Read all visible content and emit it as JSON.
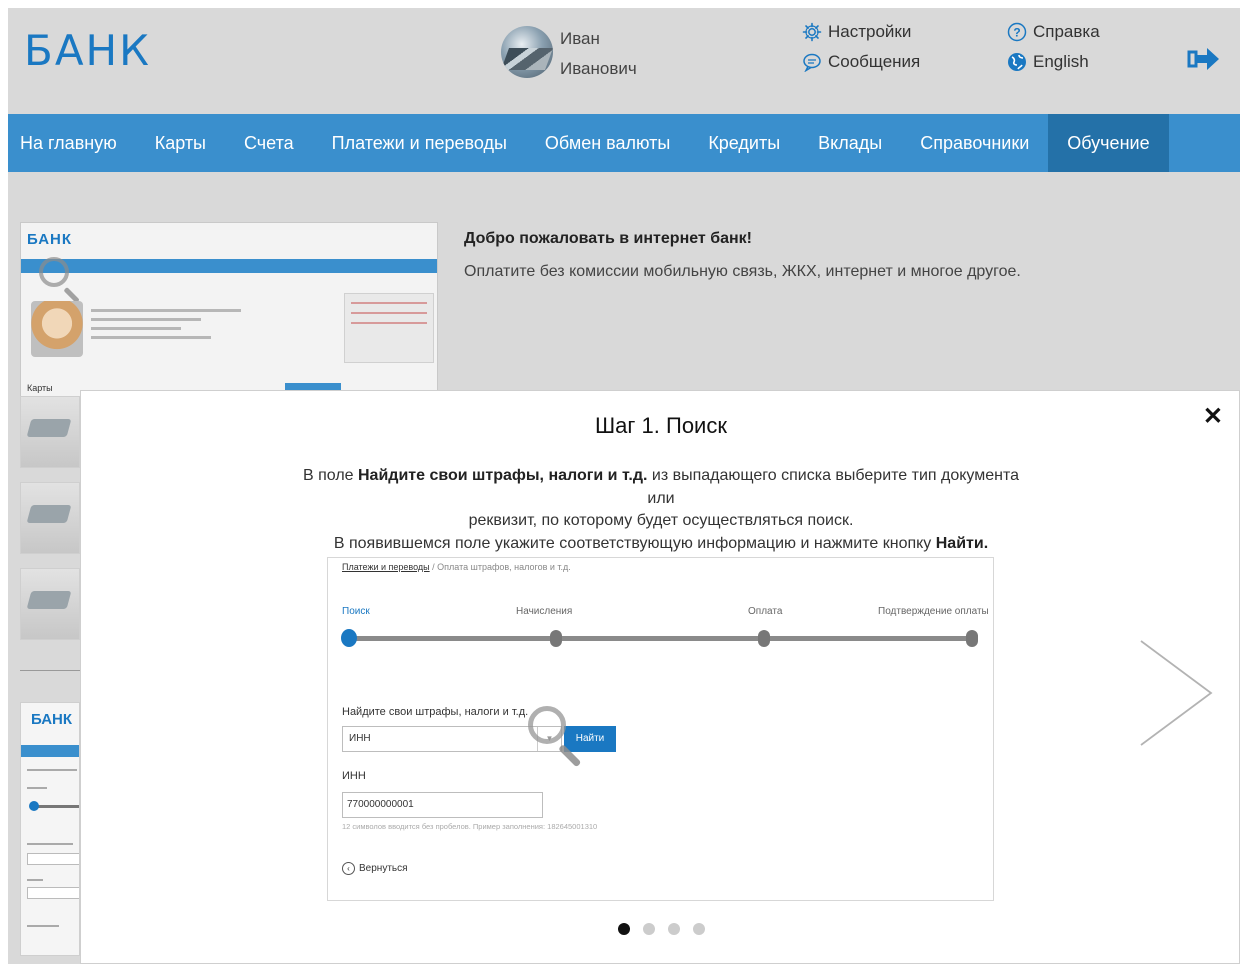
{
  "header": {
    "logo": "БАНК",
    "user": {
      "first_name": "Иван",
      "patronymic": "Иванович"
    },
    "links": {
      "settings": "Настройки",
      "messages": "Сообщения",
      "help": "Справка",
      "language": "English"
    },
    "colors": {
      "brand": "#1a78c2",
      "nav": "#3a8fcd",
      "nav_active": "#2471a8"
    }
  },
  "nav": {
    "items": [
      "На главную",
      "Карты",
      "Счета",
      "Платежи и переводы",
      "Обмен валюты",
      "Кредиты",
      "Вклады",
      "Справочники",
      "Обучение"
    ],
    "active": "Обучение"
  },
  "welcome": {
    "thumb_logo": "БАНК",
    "thumb_cards": "Карты",
    "title": "Добро пожаловать в интернет банк!",
    "text": "Оплатите без комиссии мобильную связь, ЖКХ, интернет и многое другое.",
    "mini_logo": "БАНК"
  },
  "modal": {
    "title": "Шаг 1. Поиск",
    "desc": {
      "p1_before": "В поле ",
      "p1_bold": "Найдите свои штрафы, налоги и т.д.",
      "p1_after": " из выпадающего списка выберите тип документа",
      "p2": "или",
      "p3": "реквизит, по которому будет осуществляться поиск.",
      "p4_before": "В появившемся поле укажите соответствующую информацию и нажмите кнопку ",
      "p4_bold": "Найти."
    },
    "illustration": {
      "breadcrumb_link": "Платежи и переводы",
      "breadcrumb_rest": " / Оплата штрафов, налогов и т.д.",
      "steps": [
        "Поиск",
        "Начисления",
        "Оплата",
        "Подтверждение оплаты"
      ],
      "current_step": 1,
      "search_label": "Найдите свои штрафы, налоги и т.д.",
      "select_value": "ИНН",
      "find_button": "Найти",
      "inn_label": "ИНН",
      "inn_value": "770000000001",
      "hint": "12 символов вводится без пробелов. Пример заполнения: 182645001310",
      "back": "Вернуться"
    },
    "pagination": {
      "total": 4,
      "current": 1
    }
  }
}
